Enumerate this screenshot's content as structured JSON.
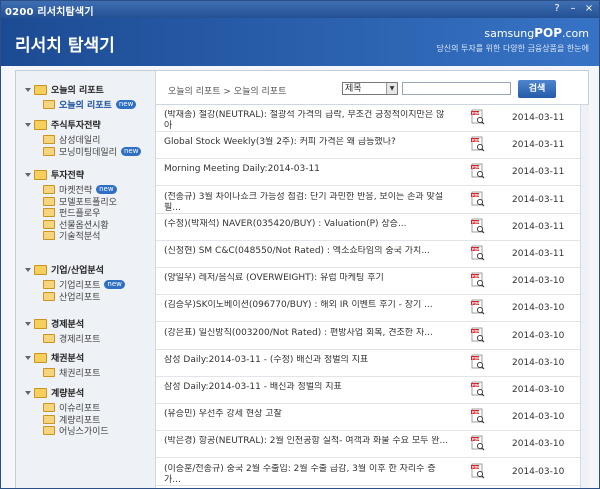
{
  "window": {
    "title": "0200 리서치탐색기",
    "controls": {
      "help": "?",
      "minimize": "–",
      "close": "×"
    }
  },
  "banner": {
    "title": "리서치 탐색기",
    "brand_prefix": "samsung",
    "brand_name": "POP",
    "brand_suffix": ".com",
    "tagline": "당신의 투자를 위한 다양한 금융상품을 한눈에"
  },
  "sidebar": {
    "new_badge": "new",
    "sections": [
      {
        "label": "오늘의 리포트",
        "items": [
          {
            "label": "오늘의 리포트",
            "new": true,
            "active": true
          }
        ]
      },
      {
        "label": "주식투자전략",
        "items": [
          {
            "label": "삼성데일리"
          },
          {
            "label": "모닝미팅데일리",
            "new": true
          }
        ]
      },
      {
        "label": "투자전략",
        "items": [
          {
            "label": "마켓전략",
            "new": true
          },
          {
            "label": "모델포트폴리오"
          },
          {
            "label": "펀드플로우"
          },
          {
            "label": "선물옵션시황"
          },
          {
            "label": "기술적분석"
          }
        ]
      },
      {
        "label": "기업/산업분석",
        "items": [
          {
            "label": "기업리포트",
            "new": true
          },
          {
            "label": "산업리포트"
          }
        ]
      },
      {
        "label": "경제분석",
        "items": [
          {
            "label": "경제리포트"
          }
        ]
      },
      {
        "label": "채권분석",
        "items": [
          {
            "label": "채권리포트"
          }
        ]
      },
      {
        "label": "계량분석",
        "items": [
          {
            "label": "이슈리포트"
          },
          {
            "label": "계량리포트"
          },
          {
            "label": "어닝스가이드"
          }
        ]
      }
    ]
  },
  "toolbar": {
    "breadcrumb": "오늘의 리포트 > 오늘의 리포트",
    "search_field": "제목",
    "search_value": "",
    "search_button": "검색"
  },
  "reports": [
    {
      "title": "(박재송) 철강(NEUTRAL): 철광석 가격의 급락, 무조건 긍정적이지만은 않아",
      "date": "2014-03-11"
    },
    {
      "title": "Global Stock Weekly(3월 2주): 커피 가격은 왜 급등했나?",
      "date": "2014-03-11"
    },
    {
      "title": "Morning Meeting Daily:2014-03-11",
      "date": "2014-03-11"
    },
    {
      "title": "(전종규) 3월 차이나쇼크 가능성 점검: 단기 과민한 반응, 보이는 손과 맞설 필...",
      "date": "2014-03-11"
    },
    {
      "title": "(수정)(박재석) NAVER(035420/BUY) : Valuation(P) 상승...",
      "date": "2014-03-11"
    },
    {
      "title": "(신정현) SM C&C(048550/Not Rated) : 엑소쇼타임의 중국 가치...",
      "date": "2014-03-11"
    },
    {
      "title": "(양일우) 레저/음식료 (OVERWEIGHT): 유럽 마케팅 후기",
      "date": "2014-03-10"
    },
    {
      "title": "(김승우)SK이노베이션(096770/BUY) : 해외 IR 이벤트 후기 - 장기 ...",
      "date": "2014-03-10"
    },
    {
      "title": "(강은표) 일신방직(003200/Not Rated) : 편방사업 회복, 견조한 자...",
      "date": "2014-03-10"
    },
    {
      "title": "삼성 Daily:2014-03-11 - (수정) 배신과 정벌의 지표",
      "date": "2014-03-10"
    },
    {
      "title": "삼성 Daily:2014-03-11 - 배신과 정벌의 지표",
      "date": "2014-03-10"
    },
    {
      "title": "(유승민) 우선주 강세 현상 고찰",
      "date": "2014-03-10"
    },
    {
      "title": "(박은경) 항공(NEUTRAL): 2월 인천공항 실적- 여객과 화물 수요 모두 완...",
      "date": "2014-03-10"
    },
    {
      "title": "(이승훈/전종규) 중국 2월 수출입: 2월 수출 급감, 3월 이후 한 자리수 증가...",
      "date": "2014-03-10"
    }
  ],
  "colors": {
    "accent": "#245ba8",
    "banner": "#1c4b93",
    "badge": "#2f6fc4"
  }
}
